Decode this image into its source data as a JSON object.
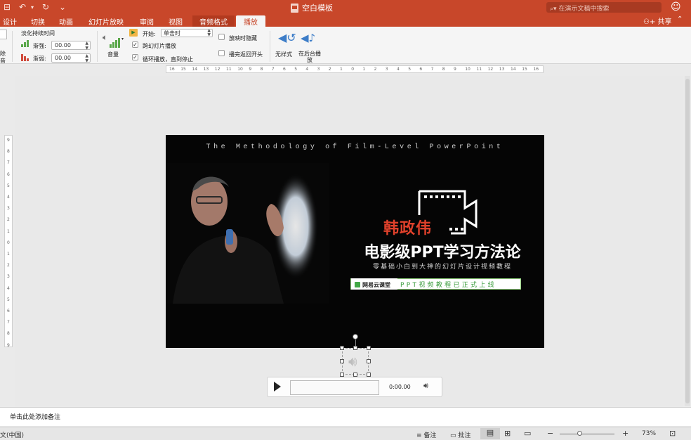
{
  "window": {
    "title": "空白模板",
    "search_placeholder": "在演示文稿中搜索",
    "share": "共享"
  },
  "quick_access": {
    "save": "⊟",
    "undo": "↶",
    "redo": "↻",
    "more": "⌄"
  },
  "tabs": [
    {
      "label": "设计"
    },
    {
      "label": "切换"
    },
    {
      "label": "动画"
    },
    {
      "label": "幻灯片放映"
    },
    {
      "label": "审阅"
    },
    {
      "label": "视图"
    },
    {
      "label": "音频格式"
    },
    {
      "label": "播放"
    }
  ],
  "ribbon": {
    "fade_group_label": "淡化持续时间",
    "fade_in_label": "渐强:",
    "fade_in_value": "00.00",
    "fade_out_label": "渐弱:",
    "fade_out_value": "00.00",
    "volume_label": "音量",
    "start_label": "开始:",
    "start_value": "单击时",
    "play_across_slides": "跨幻灯片播放",
    "loop_until_stopped": "循环播放，直到停止",
    "hide_during_show": "放映时隐藏",
    "rewind_after_playing": "播完返回开头",
    "no_style": "无样式",
    "play_in_background": "在后台播放",
    "play_across_checked": true,
    "loop_checked": true,
    "hide_checked": false,
    "rewind_checked": false,
    "left_cut_label_top": "除",
    "left_cut_label_bottom": "音"
  },
  "ruler": {
    "h_ticks": [
      "16",
      "15",
      "14",
      "13",
      "12",
      "11",
      "10",
      "9",
      "8",
      "7",
      "6",
      "5",
      "4",
      "3",
      "2",
      "1",
      "0",
      "1",
      "2",
      "3",
      "4",
      "5",
      "6",
      "7",
      "8",
      "9",
      "10",
      "11",
      "12",
      "13",
      "14",
      "15",
      "16"
    ],
    "v_ticks": [
      "9",
      "8",
      "7",
      "6",
      "5",
      "4",
      "3",
      "2",
      "1",
      "0",
      "1",
      "2",
      "3",
      "4",
      "5",
      "6",
      "7",
      "8",
      "9"
    ]
  },
  "slide": {
    "tagline": "The Methodology of Film-Level PowerPoint",
    "name": "韩政伟",
    "title": "电影级PPT学习方法论",
    "subtitle": "零基础小白到大神的幻灯片设计视频教程",
    "brand": "网易云课堂",
    "banner_text": "PPT视频教程已正式上线"
  },
  "player": {
    "time": "0:00.00"
  },
  "notes": {
    "placeholder": "单击此处添加备注"
  },
  "status": {
    "language": "文(中国)",
    "notes_btn": "备注",
    "comments_btn": "批注",
    "zoom": "73%",
    "zoom_minus": "−",
    "zoom_plus": "+"
  },
  "colors": {
    "accent": "#c8472a",
    "slide_name": "#e0412b",
    "banner_green": "#3a9c3c"
  }
}
